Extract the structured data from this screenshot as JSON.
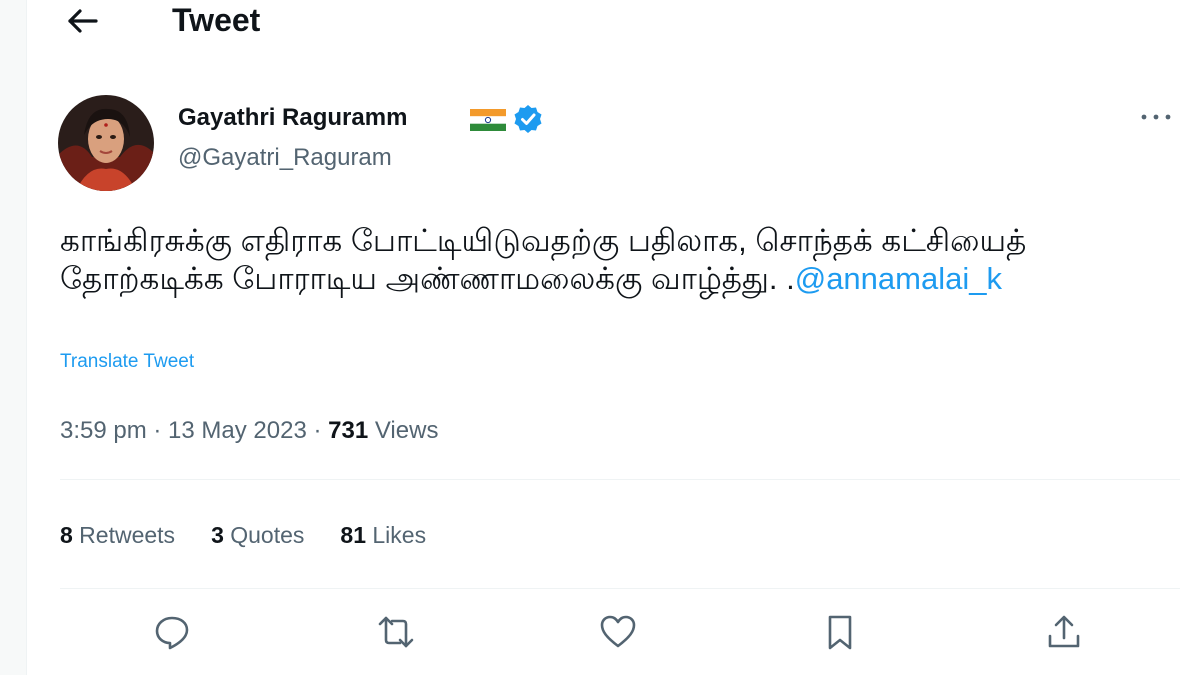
{
  "header": {
    "back_icon": "back-arrow-icon",
    "title": "Tweet"
  },
  "author": {
    "display_name": "Gayathri Raguramm",
    "handle": "@Gayatri_Raguram",
    "flag_icon": "india-flag-icon",
    "verified_icon": "verified-badge-icon",
    "more_icon": "more-options-icon"
  },
  "tweet": {
    "text_main": "காங்கிரசுக்கு எதிராக போட்டியிடுவதற்கு பதிலாக, சொந்தக் கட்சியைத் தோற்கடிக்க போராடிய அண்ணாமலைக்கு வாழ்த்து. .",
    "mention": "@annamalai_k",
    "translate_label": "Translate Tweet"
  },
  "meta": {
    "time": "3:59 pm",
    "sep1": " · ",
    "date": "13 May 2023",
    "sep2": " · ",
    "views_count": "731",
    "views_label": " Views"
  },
  "stats": {
    "retweets_count": "8",
    "retweets_label": " Retweets",
    "quotes_count": "3",
    "quotes_label": " Quotes",
    "likes_count": "81",
    "likes_label": " Likes"
  },
  "actions": {
    "reply_icon": "reply-icon",
    "retweet_icon": "retweet-icon",
    "like_icon": "like-icon",
    "bookmark_icon": "bookmark-icon",
    "share_icon": "share-icon"
  },
  "colors": {
    "accent": "#1d9bf0",
    "secondary_text": "#536471",
    "primary_text": "#0f1419",
    "divider": "#eff3f4"
  }
}
